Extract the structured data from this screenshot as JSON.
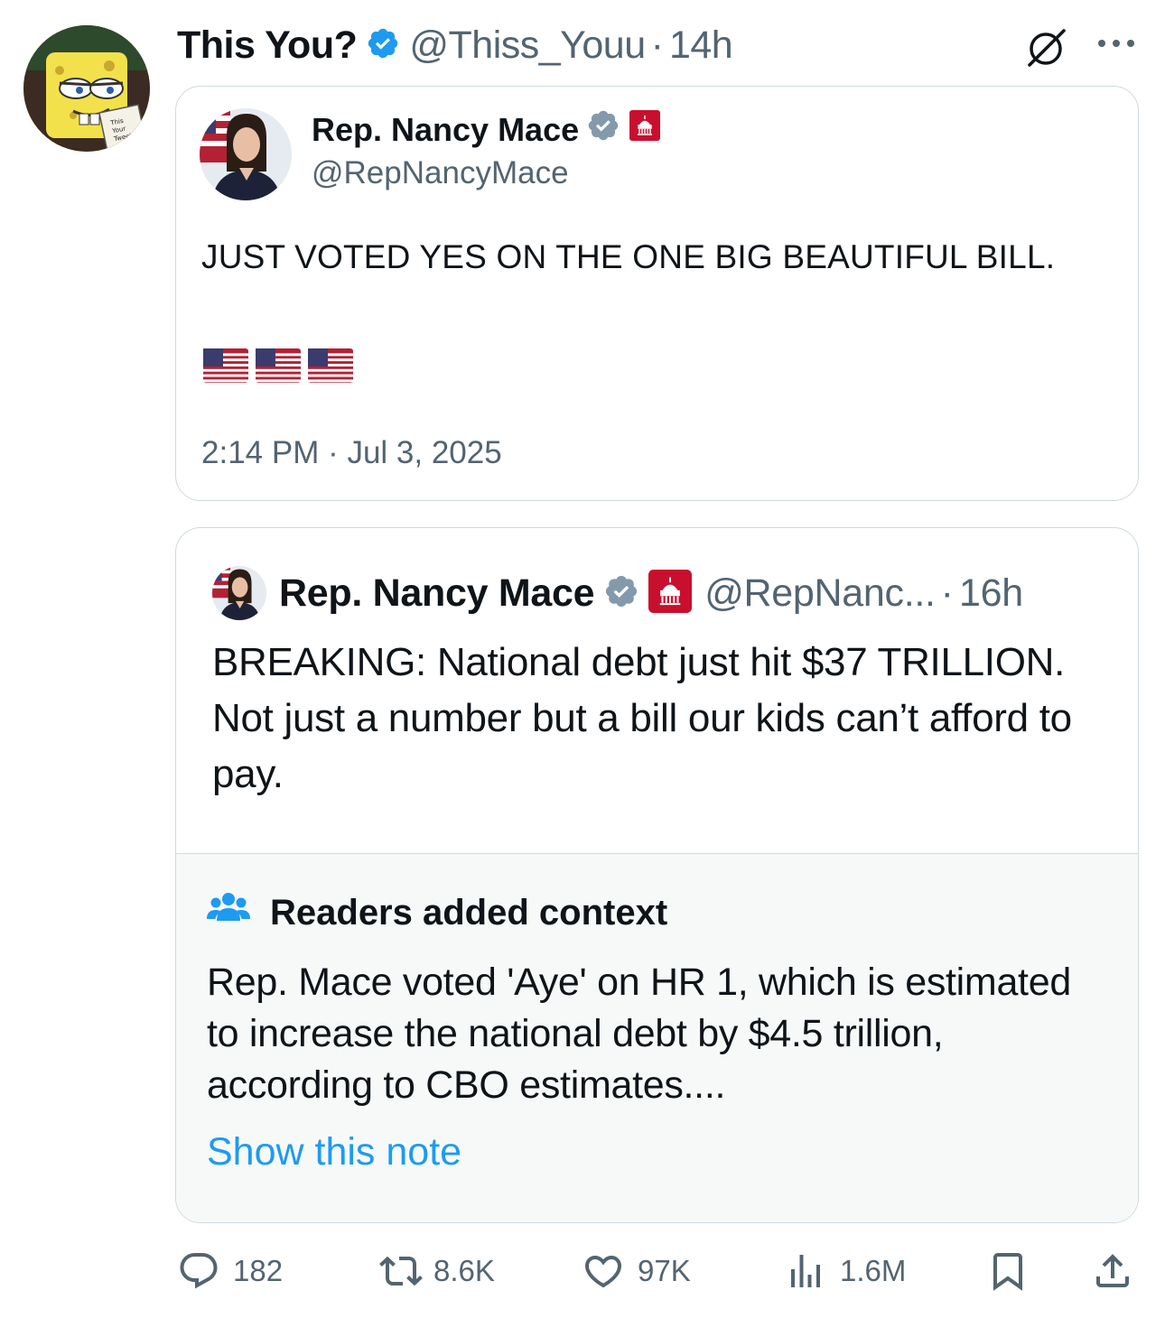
{
  "tweet": {
    "author_name": "This You?",
    "handle": "@Thiss_Youu",
    "separator": "·",
    "time": "14h",
    "avatar_text": "This Your Tweet?"
  },
  "quote1": {
    "author_name": "Rep. Nancy Mace",
    "handle": "@RepNancyMace",
    "text": "JUST VOTED YES ON THE ONE BIG BEAUTIFUL BILL.",
    "emojis": [
      "us-flag",
      "us-flag",
      "us-flag"
    ],
    "timestamp": "2:14 PM · Jul 3, 2025"
  },
  "quote2": {
    "author_name": "Rep. Nancy Mace",
    "handle": "@RepNanc...",
    "separator": "·",
    "time": "16h",
    "text": "BREAKING: National debt just hit $37 TRILLION. Not just a number but a bill our kids can’t afford to pay."
  },
  "community_note": {
    "title": "Readers added context",
    "text": "Rep. Mace voted 'Aye' on HR 1, which is estimated to increase the national debt by $4.5 trillion, according to CBO estimates....",
    "link": "Show this note"
  },
  "actions": {
    "replies": "182",
    "reposts": "8.6K",
    "likes": "97K",
    "views": "1.6M"
  },
  "colors": {
    "verified_blue": "#1d9bf0",
    "verified_gray": "#829aab",
    "gop_red": "#c8102e",
    "muted": "#536471",
    "link": "#1d9bf0"
  }
}
